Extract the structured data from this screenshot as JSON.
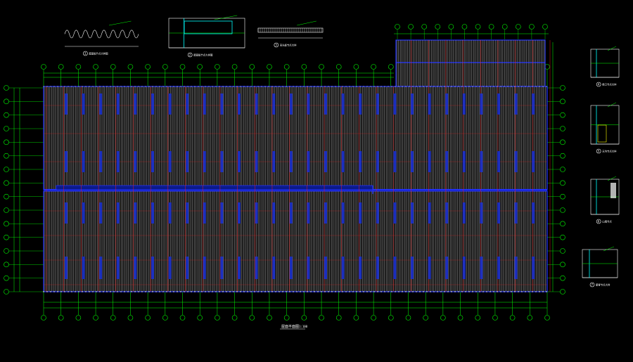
{
  "drawing": {
    "background": "#000000",
    "colors": {
      "grid_axis": "#00ff00",
      "roof_panel": "#c0c0c0",
      "purlin": "#ff2020",
      "skylight": "#2030ff",
      "text": "#ffffff",
      "detail_accent": "#00ffff",
      "dim_yellow": "#ffff00"
    },
    "plan": {
      "title": "屋面平面图",
      "scale": "1:100"
    },
    "details": [
      {
        "label": "1",
        "caption": "屋面板节点大样图"
      },
      {
        "label": "2",
        "caption": "屋面板节点大样图"
      },
      {
        "label": "3",
        "caption": "采光板节点大样"
      },
      {
        "label": "4",
        "caption": "檐口节点大样"
      },
      {
        "label": "5",
        "caption": "天沟节点大样"
      },
      {
        "label": "6",
        "caption": "山墙节点"
      },
      {
        "label": "7",
        "caption": "屋脊节点大样"
      }
    ]
  }
}
